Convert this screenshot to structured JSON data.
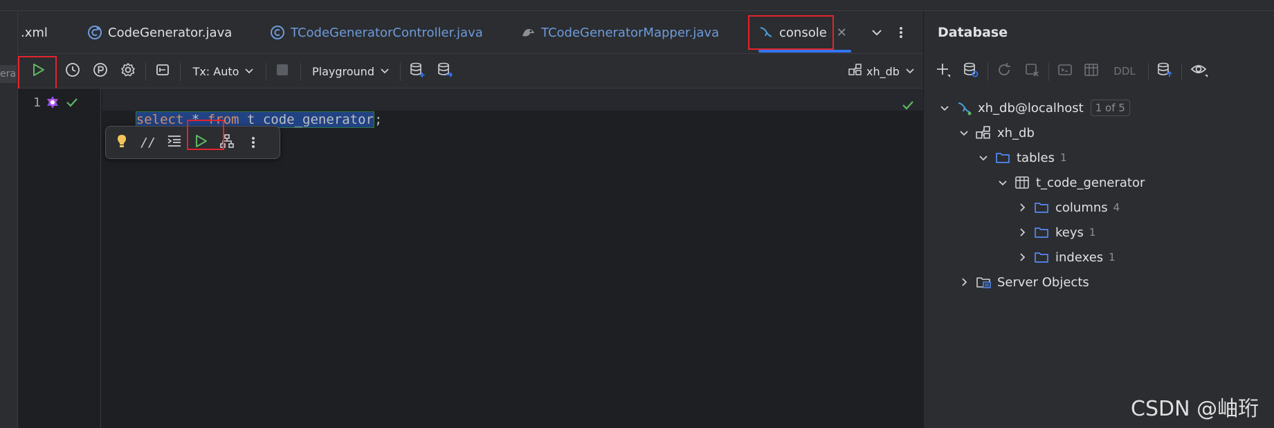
{
  "tabs": [
    {
      "label": ".xml"
    },
    {
      "label": "CodeGenerator.java"
    },
    {
      "label": "TCodeGeneratorController.java"
    },
    {
      "label": "TCodeGeneratorMapper.java"
    },
    {
      "label": "console",
      "active": true
    }
  ],
  "left_stub_text": "era",
  "toolbar": {
    "tx_label": "Tx: Auto",
    "playground_label": "Playground",
    "schema_label": "xh_db"
  },
  "editor": {
    "line_number": "1",
    "code_tokens": [
      {
        "text": "select",
        "kind": "kw"
      },
      {
        "text": " * ",
        "kind": "ident"
      },
      {
        "text": "from",
        "kind": "kw"
      },
      {
        "text": " t_code_generator",
        "kind": "ident"
      },
      {
        "text": ";",
        "kind": "punct"
      }
    ]
  },
  "database_panel": {
    "title": "Database",
    "ddl_label": "DDL",
    "tree": {
      "connection": {
        "label": "xh_db@localhost",
        "badge": "1 of 5"
      },
      "schema": {
        "label": "xh_db"
      },
      "tables": {
        "label": "tables",
        "count": "1"
      },
      "table": {
        "label": "t_code_generator"
      },
      "columns": {
        "label": "columns",
        "count": "4"
      },
      "keys": {
        "label": "keys",
        "count": "1"
      },
      "indexes": {
        "label": "indexes",
        "count": "1"
      },
      "server_objects": {
        "label": "Server Objects"
      }
    }
  },
  "watermark": "CSDN @岫珩",
  "colors": {
    "accent": "#3574f0",
    "highlight_box": "#e5232d",
    "run_green": "#5fb865"
  }
}
